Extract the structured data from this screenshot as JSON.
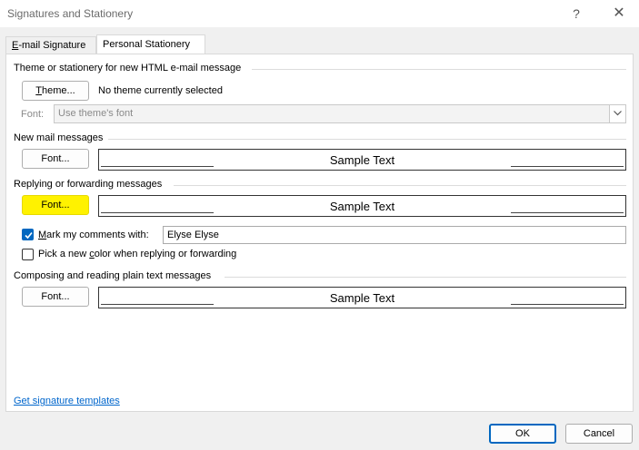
{
  "window": {
    "title": "Signatures and Stationery",
    "help": "?",
    "close": "✕"
  },
  "tabs": [
    {
      "label": "E-mail Signature",
      "accel": "E",
      "rest": "-mail Signature",
      "active": false
    },
    {
      "label": "Personal Stationery",
      "active": true
    }
  ],
  "theme_section": {
    "heading": "Theme or stationery for new HTML e-mail message",
    "theme_button_accel": "T",
    "theme_button_rest": "heme...",
    "no_theme_text": "No theme currently selected",
    "font_label": "Font:",
    "font_select_value": "Use theme's font"
  },
  "new_mail": {
    "heading": "New mail messages",
    "font_button": "Font...",
    "sample": "Sample Text"
  },
  "replying": {
    "heading": "Replying or forwarding messages",
    "font_button": "Font...",
    "sample": "Sample Text",
    "mark_comments_accel": "M",
    "mark_comments_rest": "ark my comments with:",
    "mark_comments_checked": true,
    "comments_name": "Elyse Elyse",
    "pick_color_pre": "Pick a new ",
    "pick_color_accel": "c",
    "pick_color_post": "olor when replying or forwarding",
    "pick_color_checked": false
  },
  "plain_text": {
    "heading": "Composing and reading plain text messages",
    "font_button": "Font...",
    "sample": "Sample Text"
  },
  "footer": {
    "link": "Get signature templates",
    "ok": "OK",
    "cancel": "Cancel"
  },
  "colors": {
    "accent": "#0067c0",
    "highlight": "#fff200",
    "link": "#0066cc"
  },
  "icons": {
    "dropdown": "chevron-down-icon",
    "check": "checkmark-icon"
  }
}
